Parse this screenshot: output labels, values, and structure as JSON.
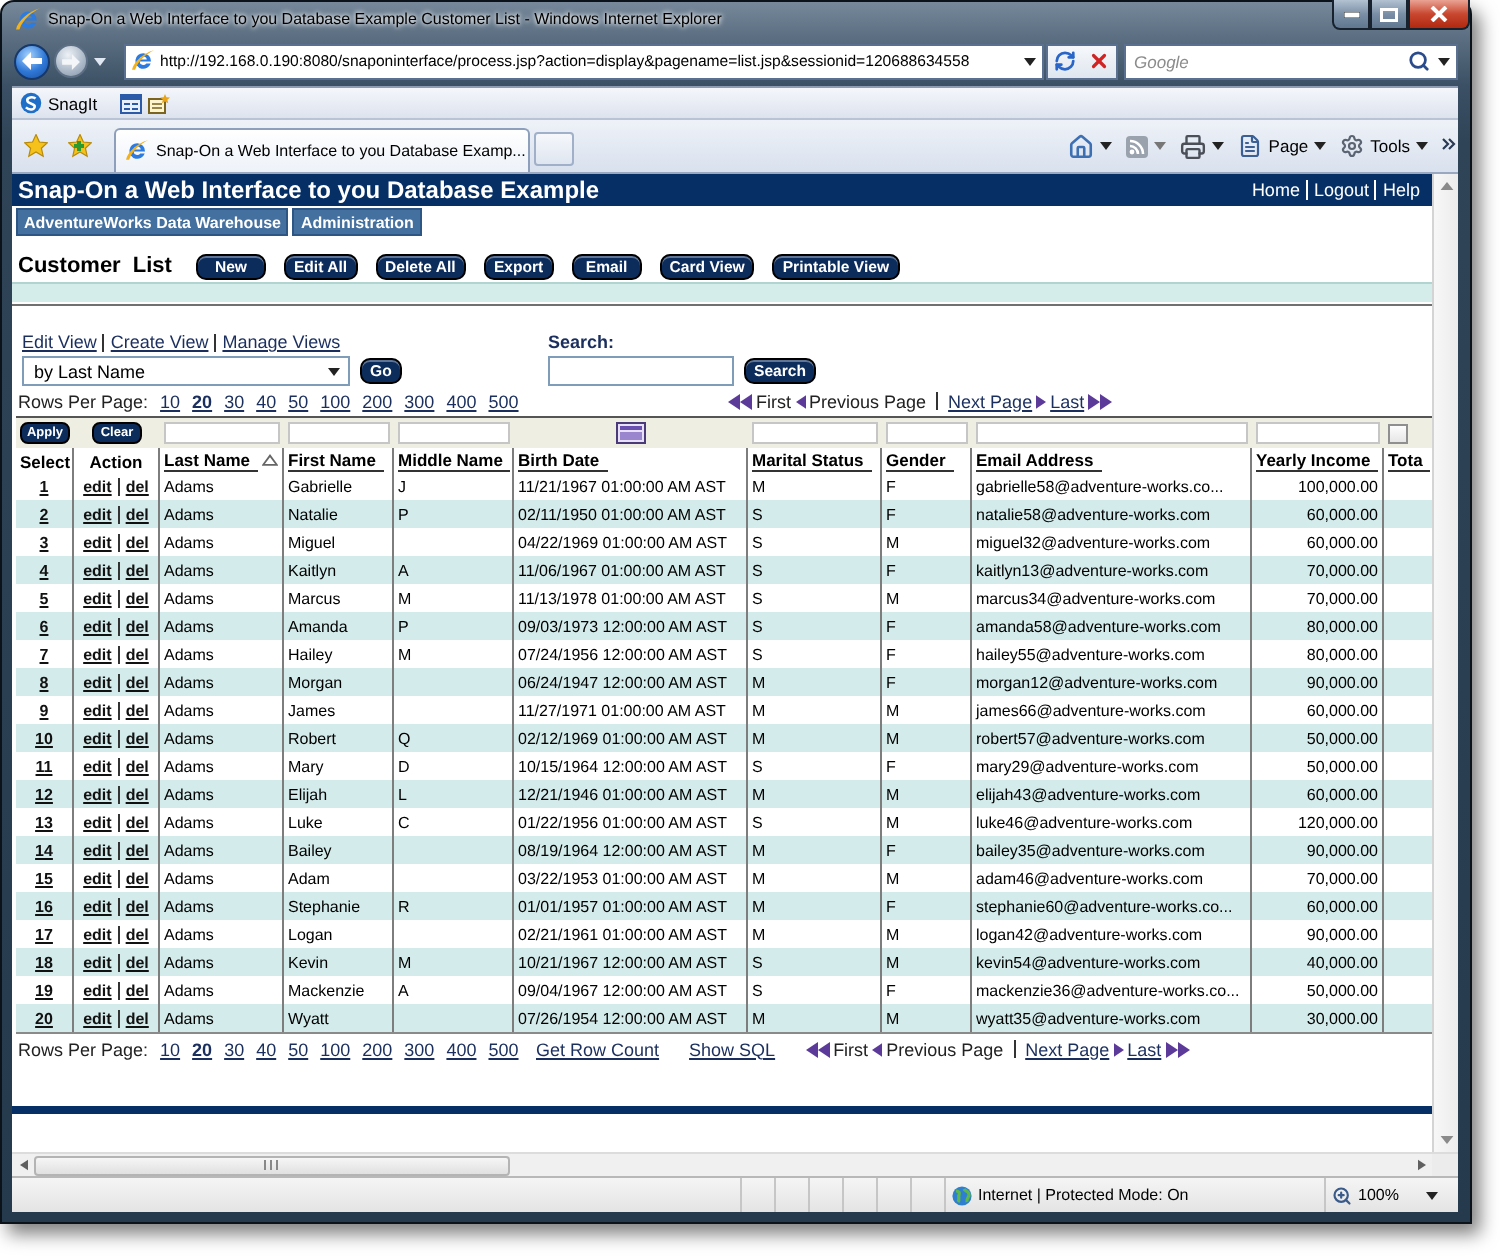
{
  "window": {
    "title": "Snap-On a Web Interface to you Database Example Customer List - Windows Internet Explorer"
  },
  "address_bar": {
    "url": "http://192.168.0.190:8080/snaponinterface/process.jsp?action=display&pagename=list.jsp&sessionid=120688634558"
  },
  "search_box": {
    "placeholder": "Google"
  },
  "links_bar": {
    "label": "SnagIt"
  },
  "tabs": [
    {
      "label": "Snap-On a Web Interface to you Database Examp...",
      "selected": true
    }
  ],
  "command_bar": [
    {
      "kind": "page",
      "label": "Page"
    },
    {
      "kind": "tools",
      "label": "Tools"
    }
  ],
  "page": {
    "title": "Snap-On a Web Interface to you Database Example",
    "top_links": [
      "Home",
      "Logout",
      "Help"
    ],
    "nav_tabs": [
      "AdventureWorks Data Warehouse",
      "Administration"
    ],
    "list_title": "Customer List",
    "actions": [
      "New",
      "Edit All",
      "Delete All",
      "Export",
      "Email",
      "Card View",
      "Printable View"
    ],
    "view_links": [
      "Edit View",
      "Create View",
      "Manage Views"
    ],
    "view_select": {
      "value": "by Last Name"
    },
    "go_button": "Go",
    "search": {
      "label": "Search:",
      "button": "Search"
    },
    "top_pager": {
      "rows_label": "Rows Per Page:",
      "page_sizes": [
        {
          "label": "10",
          "selected": false
        },
        {
          "label": "20",
          "selected": true
        },
        {
          "label": "30",
          "selected": false
        },
        {
          "label": "40",
          "selected": false
        },
        {
          "label": "50",
          "selected": false
        },
        {
          "label": "100",
          "selected": false
        },
        {
          "label": "200",
          "selected": false
        },
        {
          "label": "300",
          "selected": false
        },
        {
          "label": "400",
          "selected": false
        },
        {
          "label": "500",
          "selected": false
        }
      ],
      "nav": [
        {
          "kind": "first",
          "label": "First",
          "disabled": true
        },
        {
          "kind": "previous",
          "label": "Previous Page",
          "disabled": true
        },
        {
          "kind": "next",
          "label": "Next Page",
          "disabled": false
        },
        {
          "kind": "last",
          "label": "Last",
          "disabled": false
        }
      ]
    },
    "table": {
      "columns": [
        {
          "kind": "select",
          "label": "Select",
          "sorted": false,
          "filter": {
            "kind": "button",
            "label": "Apply"
          }
        },
        {
          "kind": "action",
          "label": "Action",
          "sorted": false,
          "filter": {
            "kind": "button",
            "label": "Clear"
          }
        },
        {
          "kind": "text",
          "label": "Last Name",
          "sorted": true,
          "filter": {
            "kind": "text"
          }
        },
        {
          "kind": "text",
          "label": "First Name",
          "sorted": false,
          "filter": {
            "kind": "text"
          }
        },
        {
          "kind": "text",
          "label": "Middle Name",
          "sorted": false,
          "filter": {
            "kind": "text"
          }
        },
        {
          "kind": "text",
          "label": "Birth Date",
          "sorted": false,
          "filter": {
            "kind": "calendar"
          }
        },
        {
          "kind": "text",
          "label": "Marital Status",
          "sorted": false,
          "filter": {
            "kind": "text"
          }
        },
        {
          "kind": "text",
          "label": "Gender",
          "sorted": false,
          "filter": {
            "kind": "text"
          }
        },
        {
          "kind": "text",
          "label": "Email Address",
          "sorted": false,
          "filter": {
            "kind": "text"
          }
        },
        {
          "kind": "number",
          "label": "Yearly Income",
          "sorted": false,
          "filter": {
            "kind": "text"
          }
        },
        {
          "kind": "text",
          "label": "Tota",
          "sorted": false,
          "filter": {
            "kind": "checkbox",
            "checked": false
          }
        }
      ],
      "rows": [
        {
          "number": "1",
          "actions": [
            "edit",
            "del"
          ],
          "last_name": "Adams",
          "first_name": "Gabrielle",
          "middle_name": "J",
          "birth_date": "11/21/1967 01:00:00 AM AST",
          "marital_status": "M",
          "gender": "F",
          "email": "gabrielle58@adventure-works.co...",
          "yearly_income": "100,000.00"
        },
        {
          "number": "2",
          "actions": [
            "edit",
            "del"
          ],
          "last_name": "Adams",
          "first_name": "Natalie",
          "middle_name": "P",
          "birth_date": "02/11/1950 01:00:00 AM AST",
          "marital_status": "S",
          "gender": "F",
          "email": "natalie58@adventure-works.com",
          "yearly_income": "60,000.00"
        },
        {
          "number": "3",
          "actions": [
            "edit",
            "del"
          ],
          "last_name": "Adams",
          "first_name": "Miguel",
          "birth_date": "04/22/1969 01:00:00 AM AST",
          "marital_status": "S",
          "gender": "M",
          "email": "miguel32@adventure-works.com",
          "yearly_income": "60,000.00"
        },
        {
          "number": "4",
          "actions": [
            "edit",
            "del"
          ],
          "last_name": "Adams",
          "first_name": "Kaitlyn",
          "middle_name": "A",
          "birth_date": "11/06/1967 01:00:00 AM AST",
          "marital_status": "S",
          "gender": "F",
          "email": "kaitlyn13@adventure-works.com",
          "yearly_income": "70,000.00"
        },
        {
          "number": "5",
          "actions": [
            "edit",
            "del"
          ],
          "last_name": "Adams",
          "first_name": "Marcus",
          "middle_name": "M",
          "birth_date": "11/13/1978 01:00:00 AM AST",
          "marital_status": "S",
          "gender": "M",
          "email": "marcus34@adventure-works.com",
          "yearly_income": "70,000.00"
        },
        {
          "number": "6",
          "actions": [
            "edit",
            "del"
          ],
          "last_name": "Adams",
          "first_name": "Amanda",
          "middle_name": "P",
          "birth_date": "09/03/1973 12:00:00 AM AST",
          "marital_status": "S",
          "gender": "F",
          "email": "amanda58@adventure-works.com",
          "yearly_income": "80,000.00"
        },
        {
          "number": "7",
          "actions": [
            "edit",
            "del"
          ],
          "last_name": "Adams",
          "first_name": "Hailey",
          "middle_name": "M",
          "birth_date": "07/24/1956 12:00:00 AM AST",
          "marital_status": "S",
          "gender": "F",
          "email": "hailey55@adventure-works.com",
          "yearly_income": "80,000.00"
        },
        {
          "number": "8",
          "actions": [
            "edit",
            "del"
          ],
          "last_name": "Adams",
          "first_name": "Morgan",
          "birth_date": "06/24/1947 12:00:00 AM AST",
          "marital_status": "M",
          "gender": "F",
          "email": "morgan12@adventure-works.com",
          "yearly_income": "90,000.00"
        },
        {
          "number": "9",
          "actions": [
            "edit",
            "del"
          ],
          "last_name": "Adams",
          "first_name": "James",
          "birth_date": "11/27/1971 01:00:00 AM AST",
          "marital_status": "M",
          "gender": "M",
          "email": "james66@adventure-works.com",
          "yearly_income": "60,000.00"
        },
        {
          "number": "10",
          "actions": [
            "edit",
            "del"
          ],
          "last_name": "Adams",
          "first_name": "Robert",
          "middle_name": "Q",
          "birth_date": "02/12/1969 01:00:00 AM AST",
          "marital_status": "M",
          "gender": "M",
          "email": "robert57@adventure-works.com",
          "yearly_income": "50,000.00"
        },
        {
          "number": "11",
          "actions": [
            "edit",
            "del"
          ],
          "last_name": "Adams",
          "first_name": "Mary",
          "middle_name": "D",
          "birth_date": "10/15/1964 12:00:00 AM AST",
          "marital_status": "S",
          "gender": "F",
          "email": "mary29@adventure-works.com",
          "yearly_income": "50,000.00"
        },
        {
          "number": "12",
          "actions": [
            "edit",
            "del"
          ],
          "last_name": "Adams",
          "first_name": "Elijah",
          "middle_name": "L",
          "birth_date": "12/21/1946 01:00:00 AM AST",
          "marital_status": "M",
          "gender": "M",
          "email": "elijah43@adventure-works.com",
          "yearly_income": "60,000.00"
        },
        {
          "number": "13",
          "actions": [
            "edit",
            "del"
          ],
          "last_name": "Adams",
          "first_name": "Luke",
          "middle_name": "C",
          "birth_date": "01/22/1956 01:00:00 AM AST",
          "marital_status": "S",
          "gender": "M",
          "email": "luke46@adventure-works.com",
          "yearly_income": "120,000.00"
        },
        {
          "number": "14",
          "actions": [
            "edit",
            "del"
          ],
          "last_name": "Adams",
          "first_name": "Bailey",
          "birth_date": "08/19/1964 12:00:00 AM AST",
          "marital_status": "M",
          "gender": "F",
          "email": "bailey35@adventure-works.com",
          "yearly_income": "90,000.00"
        },
        {
          "number": "15",
          "actions": [
            "edit",
            "del"
          ],
          "last_name": "Adams",
          "first_name": "Adam",
          "birth_date": "03/22/1953 01:00:00 AM AST",
          "marital_status": "M",
          "gender": "M",
          "email": "adam46@adventure-works.com",
          "yearly_income": "70,000.00"
        },
        {
          "number": "16",
          "actions": [
            "edit",
            "del"
          ],
          "last_name": "Adams",
          "first_name": "Stephanie",
          "middle_name": "R",
          "birth_date": "01/01/1957 01:00:00 AM AST",
          "marital_status": "M",
          "gender": "F",
          "email": "stephanie60@adventure-works.co...",
          "yearly_income": "60,000.00"
        },
        {
          "number": "17",
          "actions": [
            "edit",
            "del"
          ],
          "last_name": "Adams",
          "first_name": "Logan",
          "birth_date": "02/21/1961 01:00:00 AM AST",
          "marital_status": "M",
          "gender": "M",
          "email": "logan42@adventure-works.com",
          "yearly_income": "90,000.00"
        },
        {
          "number": "18",
          "actions": [
            "edit",
            "del"
          ],
          "last_name": "Adams",
          "first_name": "Kevin",
          "middle_name": "M",
          "birth_date": "10/21/1967 12:00:00 AM AST",
          "marital_status": "S",
          "gender": "M",
          "email": "kevin54@adventure-works.com",
          "yearly_income": "40,000.00"
        },
        {
          "number": "19",
          "actions": [
            "edit",
            "del"
          ],
          "last_name": "Adams",
          "first_name": "Mackenzie",
          "middle_name": "A",
          "birth_date": "09/04/1967 12:00:00 AM AST",
          "marital_status": "S",
          "gender": "F",
          "email": "mackenzie36@adventure-works.co...",
          "yearly_income": "50,000.00"
        },
        {
          "number": "20",
          "actions": [
            "edit",
            "del"
          ],
          "last_name": "Adams",
          "first_name": "Wyatt",
          "birth_date": "07/26/1954 12:00:00 AM AST",
          "marital_status": "M",
          "gender": "M",
          "email": "wyatt35@adventure-works.com",
          "yearly_income": "30,000.00"
        }
      ]
    },
    "bottom_pager": {
      "rows_label": "Rows Per Page:",
      "page_sizes": [
        {
          "label": "10",
          "selected": false
        },
        {
          "label": "20",
          "selected": true
        },
        {
          "label": "30",
          "selected": false
        },
        {
          "label": "40",
          "selected": false
        },
        {
          "label": "50",
          "selected": false
        },
        {
          "label": "100",
          "selected": false
        },
        {
          "label": "200",
          "selected": false
        },
        {
          "label": "300",
          "selected": false
        },
        {
          "label": "400",
          "selected": false
        },
        {
          "label": "500",
          "selected": false
        }
      ],
      "links": [
        "Get Row Count",
        "Show SQL"
      ],
      "nav": [
        {
          "kind": "first",
          "label": "First",
          "disabled": true
        },
        {
          "kind": "previous",
          "label": "Previous Page",
          "disabled": true
        },
        {
          "kind": "next",
          "label": "Next Page",
          "disabled": false
        },
        {
          "kind": "last",
          "label": "Last",
          "disabled": false
        }
      ]
    }
  },
  "status_bar": {
    "zone": "Internet | Protected Mode: On",
    "zoom": "100%"
  }
}
